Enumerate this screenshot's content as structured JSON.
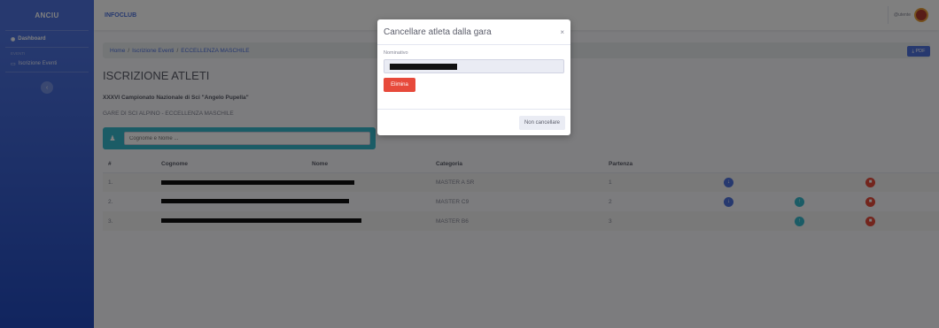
{
  "sidebar": {
    "brand": "ANCIU",
    "dashboard": "Dashboard",
    "heading": "EVENTI",
    "iscrizione": "Iscrizione Eventi",
    "toggle": "‹"
  },
  "topbar": {
    "title": "INFOCLUB",
    "user_name": "@utente"
  },
  "breadcrumb": [
    "Home",
    "Iscrizione Eventi",
    "ECCELLENZA MASCHILE"
  ],
  "page_title": "ISCRIZIONE ATLETI",
  "pdf_button": "⤓ PDF",
  "event_name": "XXXVI Campionato Nazionale di Sci \"Angelo Pupella\"",
  "event_sub": "GARE DI SCI ALPINO - ECCELLENZA MASCHILE",
  "search": {
    "placeholder": "Cognome e Nome ..."
  },
  "table": {
    "headers": [
      "#",
      "Cognome",
      "Nome",
      "Categoria",
      "Partenza"
    ],
    "rows": [
      {
        "num": "1.",
        "categoria": "MASTER A SR",
        "partenza": "1"
      },
      {
        "num": "2.",
        "categoria": "MASTER C9",
        "partenza": "2"
      },
      {
        "num": "3.",
        "categoria": "MASTER B6",
        "partenza": "3"
      }
    ]
  },
  "modal": {
    "title": "Cancellare atleta dalla gara",
    "close": "×",
    "label": "Nominativo",
    "delete_button": "Elimina",
    "cancel_button": "Non cancellare"
  },
  "colors": {
    "primary": "#4e73df",
    "info": "#36b9cc",
    "danger": "#e74a3b"
  }
}
